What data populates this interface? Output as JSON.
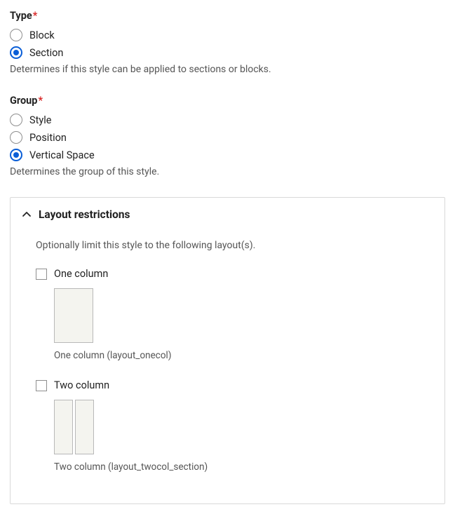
{
  "type_field": {
    "label": "Type",
    "required_marker": "*",
    "options": {
      "block": {
        "label": "Block",
        "selected": false
      },
      "section": {
        "label": "Section",
        "selected": true
      }
    },
    "help": "Determines if this style can be applied to sections or blocks."
  },
  "group_field": {
    "label": "Group",
    "required_marker": "*",
    "options": {
      "style": {
        "label": "Style",
        "selected": false
      },
      "position": {
        "label": "Position",
        "selected": false
      },
      "vertical_space": {
        "label": "Vertical Space",
        "selected": true
      }
    },
    "help": "Determines the group of this style."
  },
  "restrictions": {
    "title": "Layout restrictions",
    "help": "Optionally limit this style to the following layout(s).",
    "layouts": {
      "onecol": {
        "label": "One column",
        "caption": "One column (layout_onecol)",
        "checked": false
      },
      "twocol": {
        "label": "Two column",
        "caption": "Two column (layout_twocol_section)",
        "checked": false
      }
    }
  }
}
